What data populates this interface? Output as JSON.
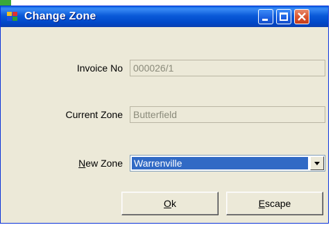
{
  "window": {
    "title": "Change Zone"
  },
  "form": {
    "invoice_label": "Invoice No",
    "invoice_value": "000026/1",
    "current_zone_label": "Current Zone",
    "current_zone_value": "Butterfield",
    "new_zone_label_mnemonic": "N",
    "new_zone_label_rest": "ew Zone",
    "new_zone_selected": "Warrenville"
  },
  "buttons": {
    "ok_mnemonic": "O",
    "ok_rest": "k",
    "escape_mnemonic": "E",
    "escape_rest": "scape"
  },
  "colors": {
    "titlebar": "#0a5ad8",
    "dialog_bg": "#ece9d8",
    "selection": "#316ac5",
    "close_button": "#d9532c"
  },
  "icons": [
    "app-icon",
    "minimize-icon",
    "maximize-icon",
    "close-icon",
    "dropdown-arrow-icon"
  ]
}
